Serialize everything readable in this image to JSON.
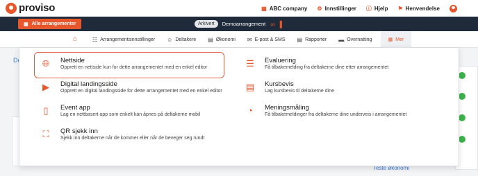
{
  "header": {
    "logo_text": "proviso",
    "actions": [
      {
        "icon": "building-icon",
        "label": "ABC company"
      },
      {
        "icon": "gear-icon",
        "label": "Innstillinger"
      },
      {
        "icon": "help-icon",
        "label": "Hjelp"
      },
      {
        "icon": "bell-icon",
        "label": "Henvendelse"
      }
    ]
  },
  "eventbar": {
    "all_events_label": "Alle arrangementer",
    "archived_badge": "Arkivert",
    "event_title": "Demoarrangement"
  },
  "nav": {
    "items": [
      {
        "icon": "settings-calendar-icon",
        "label": "Arrangementsinnstillinger"
      },
      {
        "icon": "users-icon",
        "label": "Deltakere"
      },
      {
        "icon": "money-icon",
        "label": "Økonomi"
      },
      {
        "icon": "mail-icon",
        "label": "E-post & SMS"
      },
      {
        "icon": "report-icon",
        "label": "Rapporter"
      },
      {
        "icon": "bed-icon",
        "label": "Overnatting"
      }
    ],
    "more_label": "Mer"
  },
  "dropdown": {
    "items": [
      {
        "icon": "globe-icon",
        "title": "Nettside",
        "desc": "Opprett en nettside kun for dette arrangementet med en enkel editor"
      },
      {
        "icon": "checklist-icon",
        "title": "Evaluering",
        "desc": "Få tilbakemelding fra deltakerne dine etter arrangementet"
      },
      {
        "icon": "video-icon",
        "title": "Digital landingsside",
        "desc": "Opprett en digital landingsside for dette arrangementet med en enkel editor"
      },
      {
        "icon": "certificate-icon",
        "title": "Kursbevis",
        "desc": "Lag kursbevis til deltakerne dine"
      },
      {
        "icon": "phone-icon",
        "title": "Event app",
        "desc": "Lag en nettbasert app som enkelt kan åpnes på deltakerne mobil"
      },
      {
        "icon": "pie-chart-icon",
        "title": "Meningsmåling",
        "desc": "Få tilbakemeldinger fra deltakerne dine underveis i arrangementet"
      },
      {
        "icon": "qr-scan-icon",
        "title": "QR sjekk inn",
        "desc": "Sjekk inn deltakerne når de kommer eller når de beveger seg rundt"
      }
    ]
  },
  "background": {
    "left_text": "De",
    "bottom_right_text": "Teste økonomi"
  },
  "colors": {
    "accent": "#e8562b",
    "dark": "#1f2a3a",
    "highlight": "#e25a3f"
  }
}
